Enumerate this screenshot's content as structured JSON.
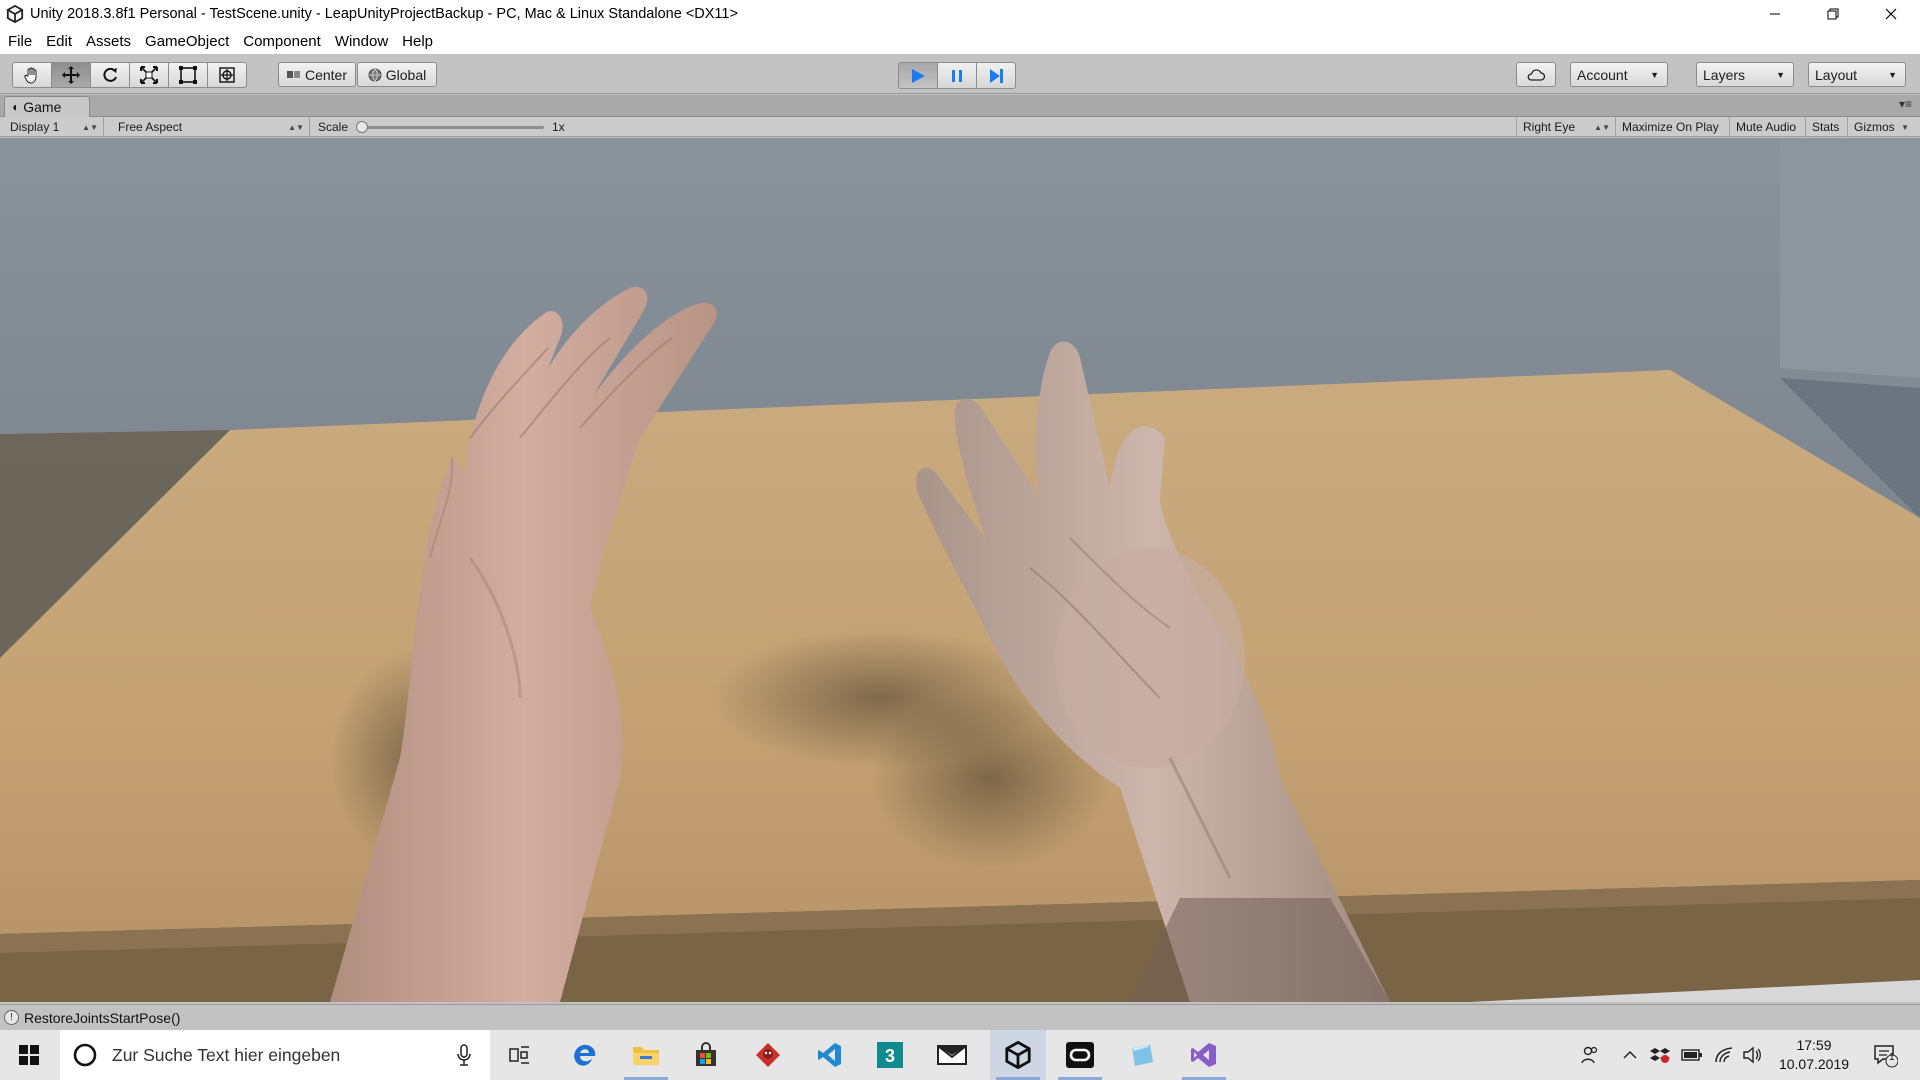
{
  "window": {
    "title": "Unity 2018.3.8f1 Personal - TestScene.unity - LeapUnityProjectBackup - PC, Mac & Linux Standalone <DX11>"
  },
  "menu": [
    "File",
    "Edit",
    "Assets",
    "GameObject",
    "Component",
    "Window",
    "Help"
  ],
  "toolbar": {
    "tools": [
      "hand-tool",
      "move-tool",
      "rotate-tool",
      "scale-tool",
      "rect-tool",
      "transform-tool"
    ],
    "active_tool": "move-tool",
    "pivot_mode": "Center",
    "pivot_rotation": "Global",
    "play_state": "playing",
    "account_label": "Account",
    "layers_label": "Layers",
    "layout_label": "Layout"
  },
  "game_view": {
    "tab_label": "Game",
    "display": "Display 1",
    "aspect": "Free Aspect",
    "scale_label": "Scale",
    "scale_value": "1x",
    "eye": "Right Eye",
    "maximize_on_play": "Maximize On Play",
    "mute_audio": "Mute Audio",
    "stats": "Stats",
    "gizmos": "Gizmos"
  },
  "status": {
    "message": "RestoreJointsStartPose()"
  },
  "taskbar": {
    "search_placeholder": "Zur Suche Text hier eingeben",
    "apps": [
      "task-view-icon",
      "edge-icon",
      "file-explorer-icon",
      "store-icon",
      "gitkraken-icon",
      "visual-studio-code-icon",
      "3d-builder-icon",
      "mail-icon",
      "unity-icon",
      "oculus-icon",
      "paint-3d-icon",
      "visual-studio-icon"
    ],
    "time": "17:59",
    "date": "10.07.2019",
    "notification_count": "1"
  },
  "colors": {
    "play_blue": "#1b7cf2",
    "unity_gray": "#c2c2c2",
    "table_wood": "#c8a878",
    "wall_gray": "#7d8690"
  }
}
